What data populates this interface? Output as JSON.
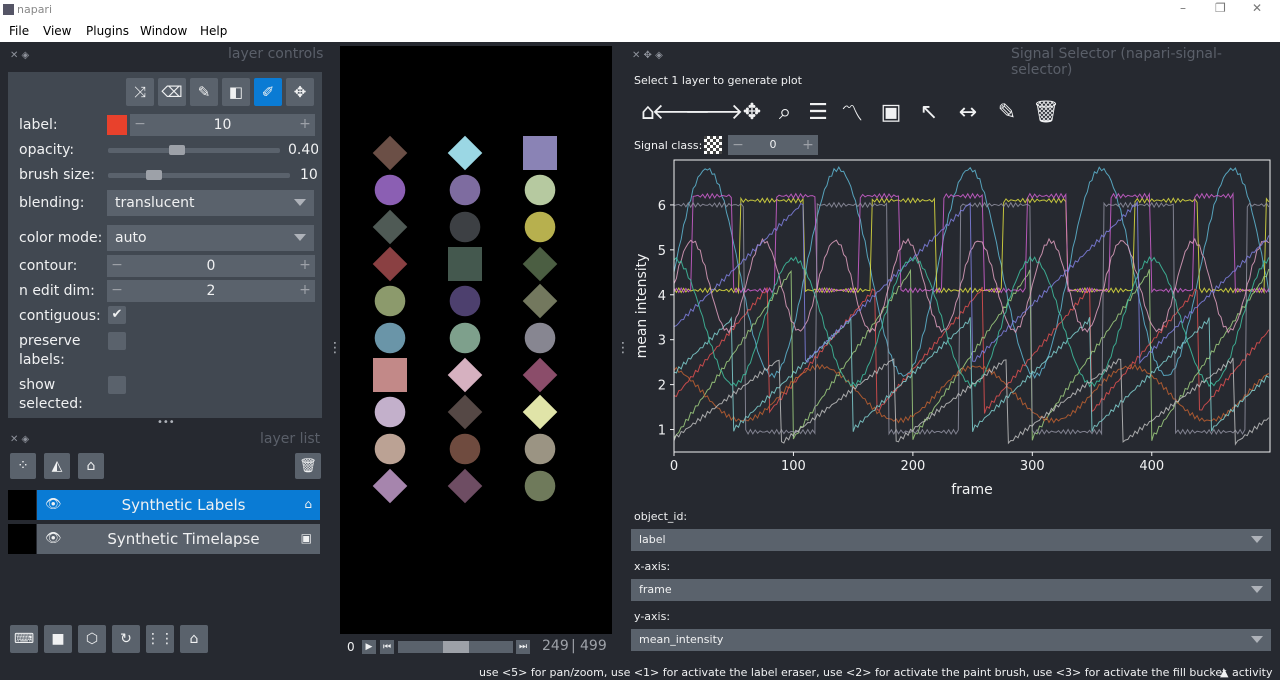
{
  "window": {
    "title": "napari",
    "controls": [
      "–",
      "❐",
      "✕"
    ]
  },
  "menu": [
    "File",
    "View",
    "Plugins",
    "Window",
    "Help"
  ],
  "layer_controls": {
    "title": "layer controls",
    "tools": [
      "shuffle-icon",
      "eraser-icon",
      "brush-icon",
      "fill-bucket-icon",
      "picker-icon",
      "pan-icon"
    ],
    "label_label": "label:",
    "label_value": "10",
    "label_color": "#e8412c",
    "opacity_label": "opacity:",
    "opacity_value": "0.40",
    "opacity_level": 0.4,
    "brush_label": "brush size:",
    "brush_value": "10",
    "brush_level": 0.25,
    "blending_label": "blending:",
    "blending_value": "translucent",
    "color_mode_label": "color mode:",
    "color_mode_value": "auto",
    "contour_label": "contour:",
    "contour_value": "0",
    "n_edit_dim_label": "n edit dim:",
    "n_edit_dim_value": "2",
    "contiguous_label": "contiguous:",
    "contiguous_checked": "✔",
    "preserve_label_1": "preserve",
    "preserve_label_2": "labels:",
    "show_selected_1": "show",
    "show_selected_2": "selected:"
  },
  "layer_list": {
    "title": "layer list",
    "layers": [
      {
        "name": "Synthetic Labels",
        "type_icon": "tag-icon",
        "selected": true
      },
      {
        "name": "Synthetic Timelapse",
        "type_icon": "image-icon",
        "selected": false
      }
    ]
  },
  "viewer_buttons": [
    "console-icon",
    "square-icon",
    "3d-cube-icon",
    "roll-icon",
    "grid-icon",
    "home-icon"
  ],
  "dims": {
    "start": "0",
    "current": "249",
    "total": "499",
    "level": 0.5
  },
  "canvas_blobs": [
    [
      "#6b4f46",
      "#9bd7e4",
      "#8a83b5"
    ],
    [
      "#8b5fb3",
      "#7e6ca0",
      "#b6c9a0"
    ],
    [
      "#4f5a55",
      "#3d4044",
      "#b7b04e"
    ],
    [
      "#8a4042",
      "#44584e",
      "#4b5e42"
    ],
    [
      "#8c9a6c",
      "#4d406e",
      "#73785e"
    ],
    [
      "#6a95a8",
      "#7ea08c",
      "#878691"
    ],
    [
      "#c28988",
      "#d6b1c0",
      "#8b4d6a"
    ],
    [
      "#c3b0cb",
      "#554845",
      "#e0e4a8"
    ],
    [
      "#bba294",
      "#6f4b3f",
      "#9b9483"
    ],
    [
      "#a685ad",
      "#6e4d63",
      "#6f7a5b"
    ]
  ],
  "signal_selector": {
    "title": "Signal Selector (napari-signal-selector)",
    "hint": "Select 1 layer to generate plot",
    "toolbar": [
      "home-icon",
      "back-arrow-icon",
      "forward-arrow-icon",
      "pan-icon",
      "zoom-icon",
      "configure-icon",
      "line-chart-icon",
      "save-icon",
      "select-icon",
      "span-icon",
      "annotate-icon",
      "trash-icon"
    ],
    "signal_class_label": "Signal class:",
    "signal_class_value": "0",
    "object_id_label": "object_id:",
    "object_id_value": "label",
    "x_axis_label": "x-axis:",
    "x_axis_value": "frame",
    "y_axis_label": "y-axis:",
    "y_axis_value": "mean_intensity"
  },
  "chart_data": {
    "type": "line",
    "xlabel": "frame",
    "ylabel": "mean intensity",
    "xlim": [
      0,
      499
    ],
    "ylim": [
      0.5,
      7
    ],
    "xticks": [
      "0",
      "100",
      "200",
      "300",
      "400"
    ],
    "yticks": [
      "1",
      "2",
      "3",
      "4",
      "5",
      "6"
    ],
    "series": [
      {
        "color": "#5fb7d4",
        "kind": "sine",
        "params": [
          4.5,
          2.3,
          110,
          0
        ]
      },
      {
        "color": "#e0e040",
        "kind": "square",
        "params": [
          4.1,
          6.1,
          110,
          0
        ]
      },
      {
        "color": "#e05050",
        "kind": "saw",
        "params": [
          1.4,
          4.2,
          90,
          10
        ]
      },
      {
        "color": "#a0d080",
        "kind": "saw",
        "params": [
          0.8,
          4.6,
          100,
          0
        ]
      },
      {
        "color": "#d060d0",
        "kind": "square",
        "params": [
          4.1,
          6.2,
          70,
          20
        ]
      },
      {
        "color": "#c06030",
        "kind": "sine",
        "params": [
          1.8,
          0.6,
          130,
          40
        ]
      },
      {
        "color": "#9090a0",
        "kind": "square",
        "params": [
          0.95,
          6.0,
          120,
          60
        ]
      },
      {
        "color": "#80d0d0",
        "kind": "saw",
        "params": [
          1.0,
          3.5,
          100,
          50
        ]
      },
      {
        "color": "#e0a0c0",
        "kind": "sine",
        "params": [
          4.2,
          1.0,
          60,
          0
        ]
      },
      {
        "color": "#8080e0",
        "kind": "saw",
        "params": [
          2.5,
          6.1,
          140,
          30
        ]
      },
      {
        "color": "#40c0a0",
        "kind": "sine",
        "params": [
          3.4,
          1.4,
          100,
          25
        ]
      },
      {
        "color": "#c0c0c0",
        "kind": "saw",
        "params": [
          0.7,
          2.6,
          95,
          5
        ]
      }
    ]
  },
  "status_bar": {
    "text": "use <5> for pan/zoom, use <1> for activate the label eraser, use <2> for activate the paint brush, use <3> for activate the fill bucket",
    "activity": "▲ activity"
  }
}
